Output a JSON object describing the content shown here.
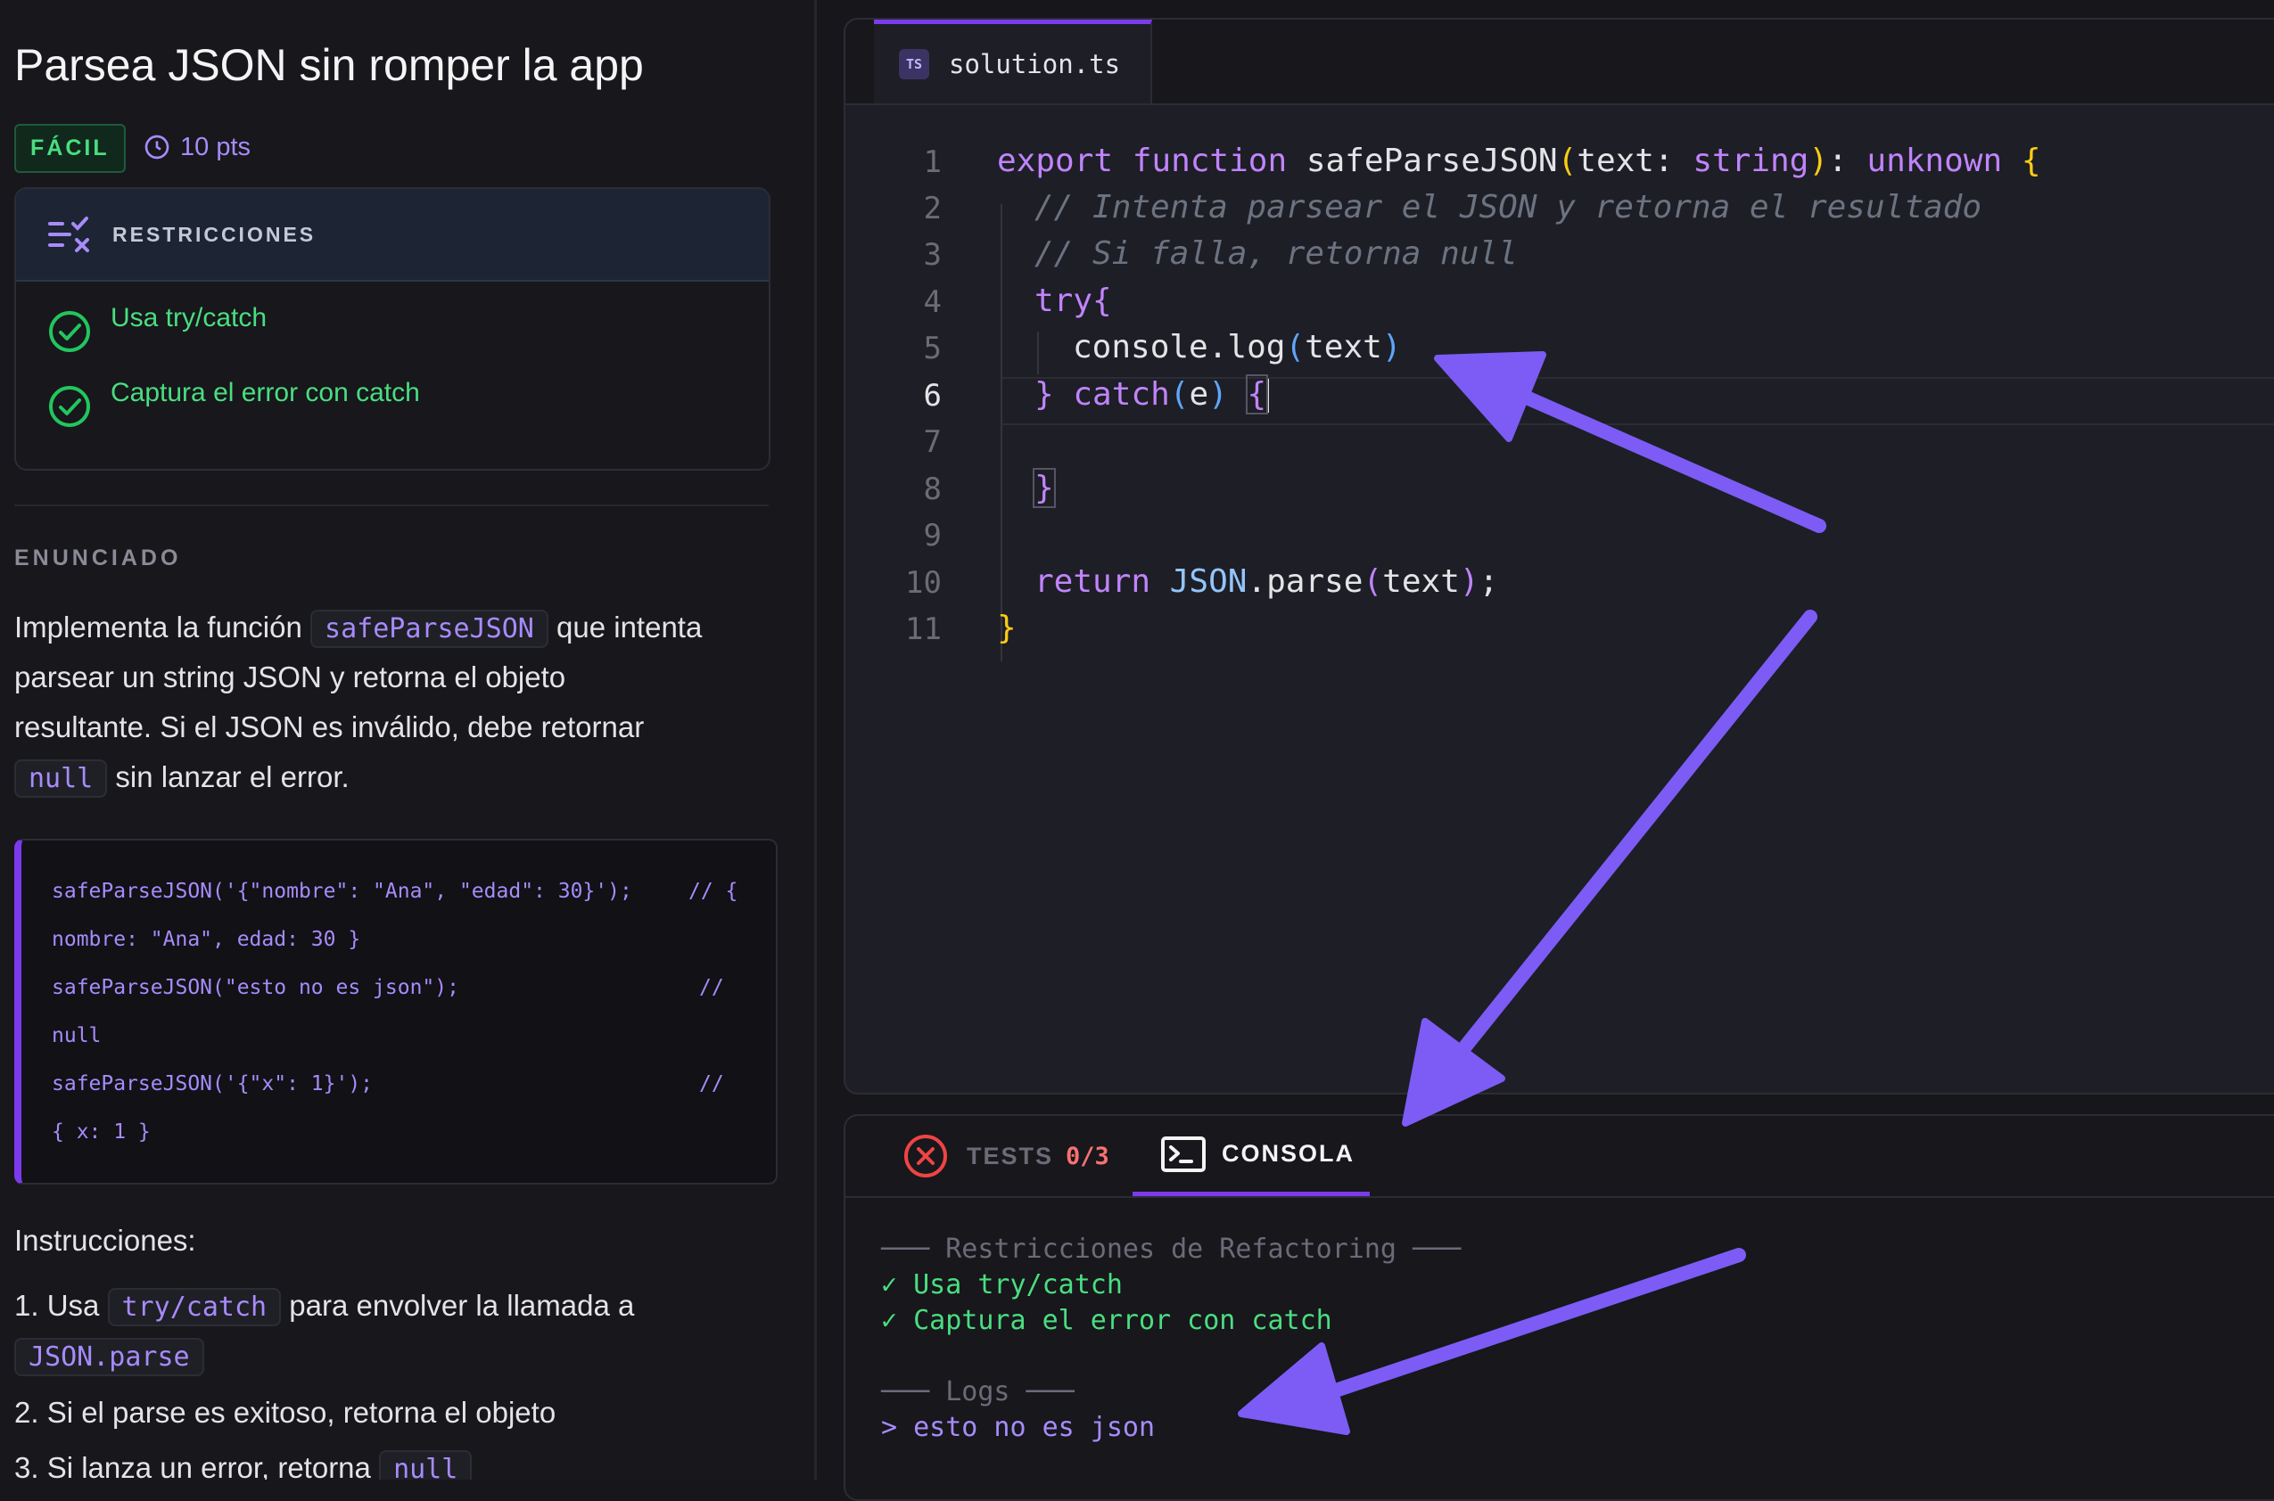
{
  "problem": {
    "title": "Parsea JSON sin romper la app",
    "difficulty": "FÁCIL",
    "points": "10 pts"
  },
  "restrictions": {
    "title": "RESTRICCIONES",
    "items": [
      "Usa try/catch",
      "Captura el error con catch"
    ]
  },
  "statement": {
    "section_label": "ENUNCIADO",
    "p1_before": "Implementa la función",
    "p1_code": "safeParseJSON",
    "p1_after": "que intenta",
    "p2": "parsear un string JSON y retorna el objeto",
    "p3": "resultante. Si el JSON es inválido, debe retornar",
    "p4_code": "null",
    "p4_after": "sin lanzar el error."
  },
  "example": {
    "lines": [
      {
        "code": "safeParseJSON('{\"nombre\": \"Ana\", \"edad\": 30}');",
        "comment": "// {"
      },
      {
        "code": "nombre: \"Ana\", edad: 30 }",
        "comment": ""
      },
      {
        "code": "safeParseJSON(\"esto no es json\");",
        "comment": "//"
      },
      {
        "code": "null",
        "comment": ""
      },
      {
        "code": "safeParseJSON('{\"x\": 1}');",
        "comment": "//"
      },
      {
        "code": "{ x: 1 }",
        "comment": ""
      }
    ]
  },
  "instructions": {
    "title": "Instrucciones:",
    "i1_before": "1. Usa",
    "i1_code": "try/catch",
    "i1_after": "para envolver la llamada a",
    "i1_code2": "JSON.parse",
    "i2": "2. Si el parse es exitoso, retorna el objeto",
    "i3_before": "3. Si lanza un error, retorna",
    "i3_code": "null"
  },
  "editor": {
    "tab_badge": "TS",
    "filename": "solution.ts",
    "line_numbers": [
      "1",
      "2",
      "3",
      "4",
      "5",
      "6",
      "7",
      "8",
      "9",
      "10",
      "11"
    ],
    "active_line": "6",
    "code": {
      "l1_export": "export",
      "l1_function": "function",
      "l1_name": "safeParseJSON",
      "l1_open": "(",
      "l1_params": "text: ",
      "l1_type": "string",
      "l1_close": ")",
      "l1_colon": ": ",
      "l1_ret": "unknown",
      "l1_brace": "{",
      "l2": "// Intenta parsear el JSON y retorna el resultado",
      "l3": "// Si falla, retorna null",
      "l4_try": "try",
      "l4_brace": "{",
      "l5_obj": "console",
      "l5_method": ".log",
      "l5_open": "(",
      "l5_arg": "text",
      "l5_close": ")",
      "l6_brace": "}",
      "l6_catch": "catch",
      "l6_open": "(",
      "l6_arg": "e",
      "l6_close": ")",
      "l6_brace2": "{",
      "l8": "}",
      "l10_return": "return",
      "l10_obj": "JSON",
      "l10_method": ".parse",
      "l10_open": "(",
      "l10_arg": "text",
      "l10_close": ")",
      "l10_semi": ";",
      "l11": "}"
    }
  },
  "bottom": {
    "tests_label": "TESTS",
    "tests_count": "0/3",
    "console_label": "CONSOLA",
    "console": {
      "header1": "─── Restricciones de Refactoring ───",
      "ok1": "✓ Usa try/catch",
      "ok2": "✓ Captura el error con catch",
      "header2": "─── Logs ───",
      "log1": "> esto no es json"
    }
  },
  "colors": {
    "accent": "#7c3aed",
    "success": "#4ade80",
    "error": "#ef4444",
    "arrow": "#7c5cf5"
  },
  "icons": [
    "clock-icon",
    "restrictions-list-icon",
    "check-circle-icon",
    "typescript-file-icon",
    "error-circle-icon",
    "terminal-icon"
  ]
}
